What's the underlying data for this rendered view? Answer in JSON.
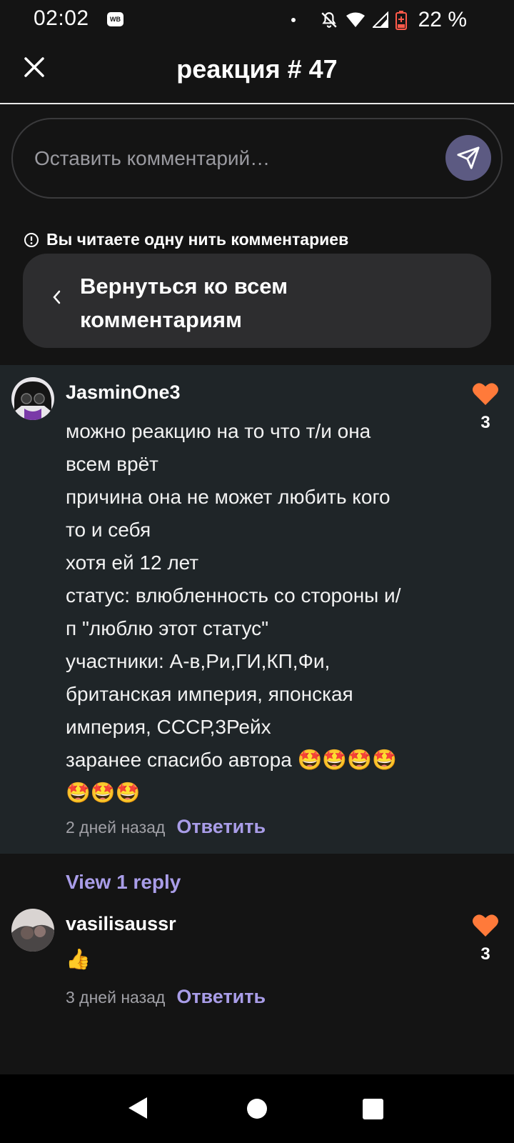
{
  "status_bar": {
    "time": "02:02",
    "app_badge": "WB",
    "battery_percent": "22 %",
    "icons": [
      "notification-dot",
      "bell-off-icon",
      "wifi-icon",
      "signal-icon",
      "battery-icon"
    ]
  },
  "header": {
    "title": "реакция # 47",
    "close_icon": "close-icon"
  },
  "comment_input": {
    "placeholder": "Оставить комментарий…",
    "send_icon": "send-icon",
    "send_color": "#5c5a82"
  },
  "thread": {
    "notice": "Вы читаете одну нить комментариев",
    "back_label": "Вернуться ко всем комментариям"
  },
  "comments": [
    {
      "username": "JasminOne3",
      "text": "можно реакцию на то что т/и  она\nвсем врёт\nпричина она не может любить кого\nто и себя\nхотя ей 12 лет\nстатус: влюбленность со стороны и/\nп \"люблю этот статус\"\nучастники: А-в,Ри,ГИ,КП,Фи,\nбританская империя, японская\nимперия, СССР,3Рейх\nзаранее спасибо автора 🤩🤩🤩🤩\n🤩🤩🤩",
      "time": "2 дней назад",
      "reply_label": "Ответить",
      "likes": "3"
    },
    {
      "username": "vasilisaussr",
      "text": "👍",
      "time": "3 дней назад",
      "reply_label": "Ответить",
      "likes": "3"
    }
  ],
  "view_replies_label": "View 1 reply",
  "colors": {
    "accent": "#a99de8",
    "like": "#ff7a3a",
    "background": "#141414",
    "highlight_comment_bg": "#1f2528"
  }
}
